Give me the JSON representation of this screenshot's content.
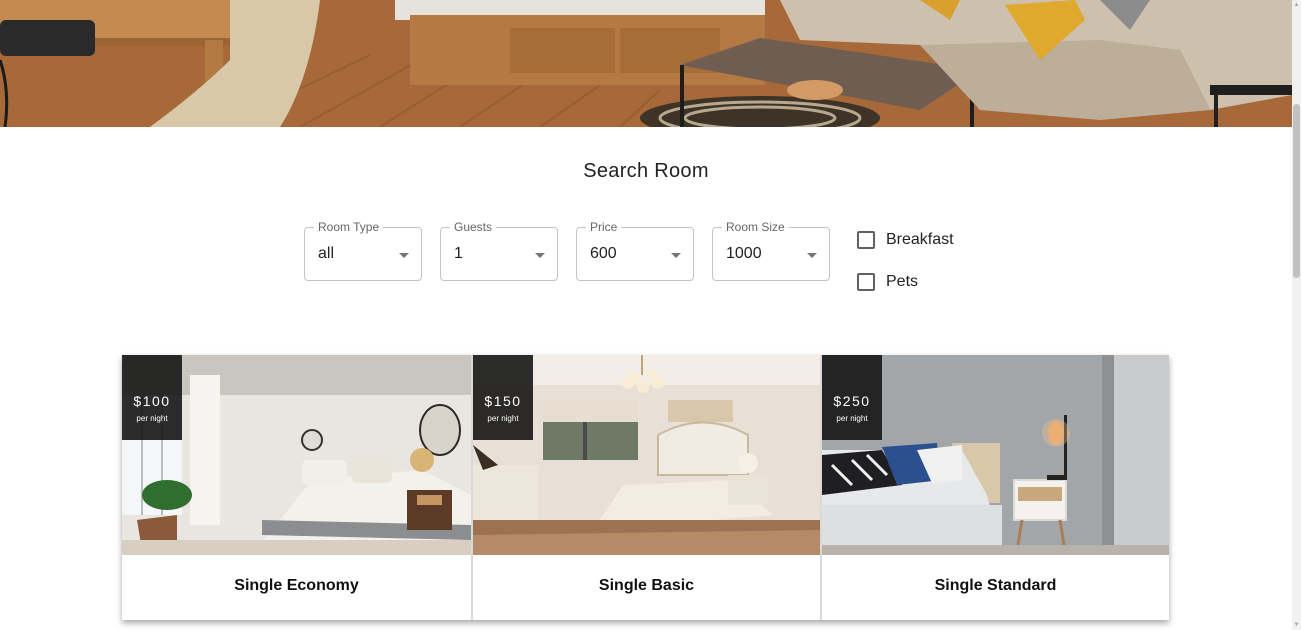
{
  "search": {
    "title": "Search Room",
    "filters": [
      {
        "label": "Room Type",
        "value": "all"
      },
      {
        "label": "Guests",
        "value": "1"
      },
      {
        "label": "Price",
        "value": "600"
      },
      {
        "label": "Room Size",
        "value": "1000"
      }
    ],
    "checkboxes": [
      {
        "label": "Breakfast",
        "checked": false
      },
      {
        "label": "Pets",
        "checked": false
      }
    ]
  },
  "rooms": [
    {
      "name": "Single Economy",
      "price": "$100",
      "price_unit": "per night"
    },
    {
      "name": "Single Basic",
      "price": "$150",
      "price_unit": "per night"
    },
    {
      "name": "Single Standard",
      "price": "$250",
      "price_unit": "per night"
    }
  ],
  "colors": {
    "price_tag_bg": "#161616",
    "field_border": "#c4c4c4",
    "checkbox_border": "#616161"
  },
  "icons": {
    "select_caret": "chevron-down-icon",
    "checkbox": "checkbox-unchecked-icon"
  }
}
